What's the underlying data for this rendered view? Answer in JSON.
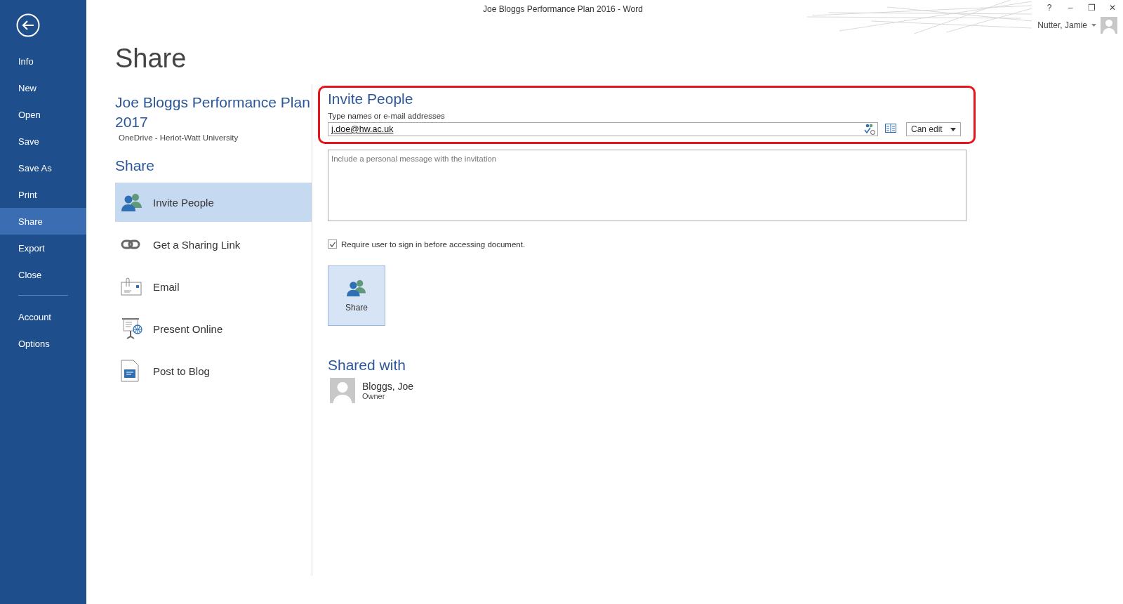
{
  "window": {
    "title": "Joe Bloggs Performance Plan 2016 - Word",
    "controls": [
      "?",
      "–",
      "❐",
      "✕"
    ],
    "user": "Nutter, Jamie"
  },
  "sidebar": {
    "items": [
      {
        "label": "Info",
        "selected": false
      },
      {
        "label": "New",
        "selected": false
      },
      {
        "label": "Open",
        "selected": false
      },
      {
        "label": "Save",
        "selected": false
      },
      {
        "label": "Save As",
        "selected": false
      },
      {
        "label": "Print",
        "selected": false
      },
      {
        "label": "Share",
        "selected": true
      },
      {
        "label": "Export",
        "selected": false
      },
      {
        "label": "Close",
        "selected": false
      }
    ],
    "lower_items": [
      {
        "label": "Account",
        "selected": false
      },
      {
        "label": "Options",
        "selected": false
      }
    ]
  },
  "page_title": "Share",
  "document": {
    "name": "Joe Bloggs Performance Plan 2017",
    "location": "OneDrive - Heriot-Watt University"
  },
  "share_heading": "Share",
  "share_options": [
    {
      "kind": "people",
      "label": "Invite People",
      "selected": true
    },
    {
      "kind": "link",
      "label": "Get a Sharing Link",
      "selected": false
    },
    {
      "kind": "email",
      "label": "Email",
      "selected": false
    },
    {
      "kind": "present",
      "label": "Present Online",
      "selected": false
    },
    {
      "kind": "blog",
      "label": "Post to Blog",
      "selected": false
    }
  ],
  "invite": {
    "heading": "Invite People",
    "field_label": "Type names or e-mail addresses",
    "recipients": "j.doe@hw.ac.uk",
    "permission": "Can edit",
    "message_placeholder": "Include a personal message with the invitation",
    "require_sign_in": {
      "label": "Require user to sign in before accessing document.",
      "checked": true
    },
    "share_button": "Share"
  },
  "shared_with": {
    "heading": "Shared with",
    "people": [
      {
        "name": "Bloggs, Joe",
        "role": "Owner"
      }
    ]
  }
}
